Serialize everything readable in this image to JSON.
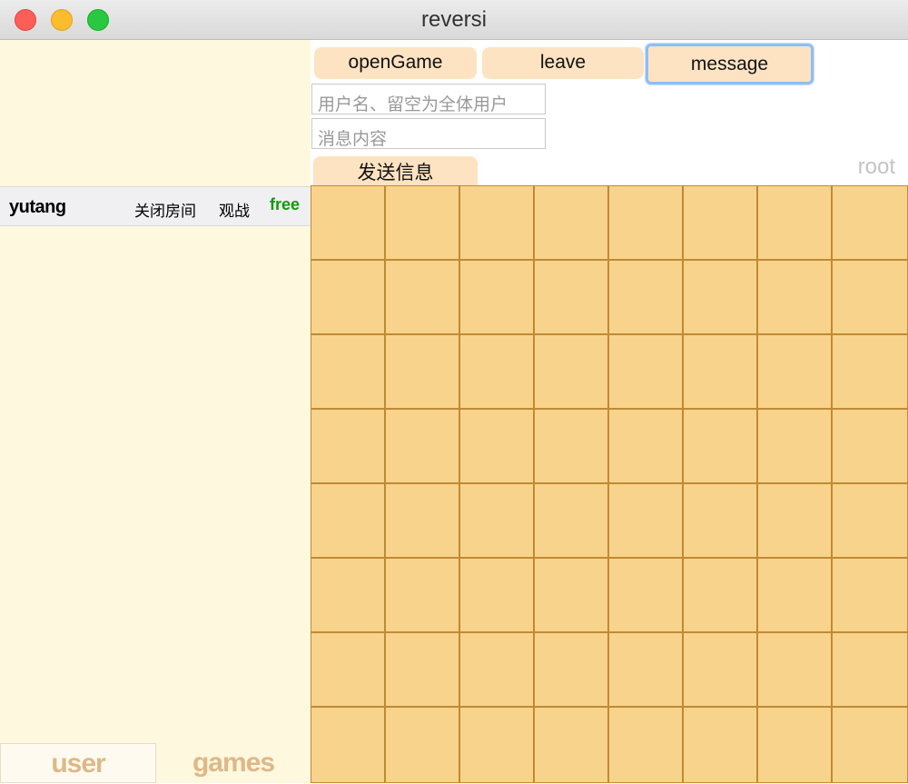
{
  "window": {
    "title": "reversi"
  },
  "toolbar": {
    "open_game": "openGame",
    "leave": "leave",
    "message": "message",
    "username_placeholder": "用户名、留空为全体用户",
    "message_placeholder": "消息内容",
    "send": "发送信息",
    "current_user": "root"
  },
  "rooms": [
    {
      "name": "yutang",
      "close_label": "关闭房间",
      "watch_label": "观战",
      "status": "free"
    }
  ],
  "tabs": {
    "user": "user",
    "games": "games"
  },
  "board": {
    "rows": 8,
    "cols": 8
  },
  "colors": {
    "board": "#f8d38c",
    "board_lines": "#c08a33",
    "sidebar": "#fef8de",
    "button": "#fde3c2",
    "status_free": "#119a0a"
  }
}
